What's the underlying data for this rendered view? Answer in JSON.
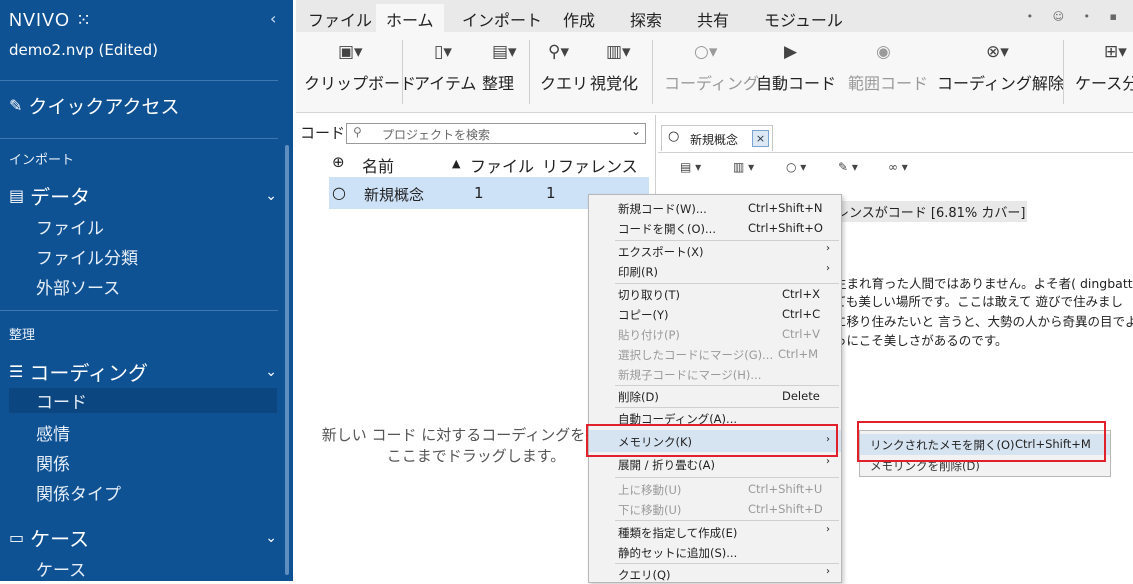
{
  "sidebar": {
    "logo": "NVIVO",
    "collapse_icon": "‹",
    "project": "demo2.nvp (Edited)",
    "quick_access": "クイックアクセス",
    "import_label": "インポート",
    "data_group": "データ",
    "data_items": [
      "ファイル",
      "ファイル分類",
      "外部ソース"
    ],
    "organize_label": "整理",
    "coding_group": "コーディング",
    "coding_items": [
      "コード",
      "感情",
      "関係",
      "関係タイプ"
    ],
    "cases_group": "ケース",
    "cases_items": [
      "ケース"
    ]
  },
  "ribbon_tabs": [
    "ファイル",
    "ホーム",
    "インポート",
    "作成",
    "探索",
    "共有",
    "モジュール"
  ],
  "ribbon": {
    "clipboard": "クリップボード",
    "item": "アイテム",
    "organize": "整理",
    "query": "クエリ",
    "visualize": "視覚化",
    "coding": "コーディング",
    "auto_code": "自動コード",
    "range_code": "範囲コード",
    "uncode": "コーディング解除",
    "case": "ケース分"
  },
  "list": {
    "title": "コード",
    "search_placeholder": "プロジェクトを検索",
    "col_name": "名前",
    "col_files": "ファイル",
    "col_refs": "リファレンス",
    "row": {
      "name": "新規概念",
      "files": "1",
      "refs": "1"
    },
    "empty_line1": "新しい コード に対するコーディングを行うに",
    "empty_line2": "ここまでドラッグします。"
  },
  "detail": {
    "tab_label": "新規概念",
    "tab_close": "×",
    "coverage": "レンスがコード [6.81% カバー]",
    "lines": [
      "生まれ育った人間ではありません。よそ者( dingbatt",
      "ても美しい場所です。ここは敢えて 遊びで住みまし",
      "に移り住みたいと 言うと、大勢の人から奇異の目でよ",
      "っにこそ美しさがあるのです。"
    ]
  },
  "context_menu": {
    "items": [
      {
        "label": "新規コード(W)...",
        "shortcut": "Ctrl+Shift+N"
      },
      {
        "label": "コードを開く(O)...",
        "shortcut": "Ctrl+Shift+O"
      },
      {
        "label": "エクスポート(X)",
        "submenu": "›"
      },
      {
        "label": "印刷(R)",
        "submenu": "›"
      },
      {
        "label": "切り取り(T)",
        "shortcut": "Ctrl+X"
      },
      {
        "label": "コピー(Y)",
        "shortcut": "Ctrl+C"
      },
      {
        "label": "貼り付け(P)",
        "shortcut": "Ctrl+V"
      },
      {
        "label": "選択したコードにマージ(G)...",
        "shortcut": "Ctrl+M"
      },
      {
        "label": "新規子コードにマージ(H)..."
      },
      {
        "label": "削除(D)",
        "shortcut": "Delete"
      },
      {
        "label": "自動コーディング(A)..."
      },
      {
        "label": "メモリンク(K)",
        "submenu": "›"
      },
      {
        "label": "展開 / 折り畳む(A)",
        "submenu": "›"
      },
      {
        "label": "上に移動(U)",
        "shortcut": "Ctrl+Shift+U"
      },
      {
        "label": "下に移動(U)",
        "shortcut": "Ctrl+Shift+D"
      },
      {
        "label": "種類を指定して作成(E)",
        "submenu": "›"
      },
      {
        "label": "静的セットに追加(S)..."
      },
      {
        "label": "クエリ(Q)",
        "submenu": "›"
      }
    ]
  },
  "submenu": {
    "open_memo": "リンクされたメモを開く(O)",
    "open_memo_shortcut": "Ctrl+Shift+M",
    "delete_memo": "メモリンクを削除(D)"
  },
  "colors": {
    "sidebar": "#0f5294",
    "highlight_box": "#e0212b",
    "selected_row": "#cde1f7"
  }
}
